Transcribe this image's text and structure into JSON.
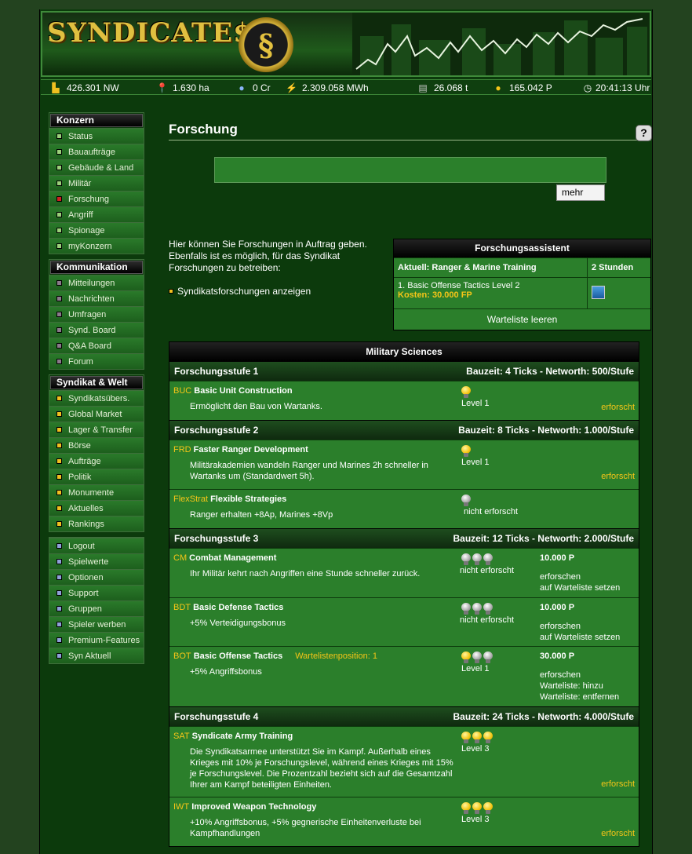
{
  "header": {
    "logo": "SYNDICATE$",
    "emblem_glyph": "§"
  },
  "status": {
    "networth": "426.301 NW",
    "land": "1.630 ha",
    "credits": "0 Cr",
    "energy": "2.309.058 MWh",
    "steel": "26.068 t",
    "points": "165.042 P",
    "time": "20:41:13 Uhr"
  },
  "sidebar": {
    "sections": [
      {
        "title": "Konzern",
        "items": [
          {
            "label": "Status",
            "color": "#9bd07a"
          },
          {
            "label": "Bauaufträge",
            "color": "#9bd07a"
          },
          {
            "label": "Gebäude & Land",
            "color": "#9bd07a"
          },
          {
            "label": "Militär",
            "color": "#9bd07a"
          },
          {
            "label": "Forschung",
            "color": "#cc2222"
          },
          {
            "label": "Angriff",
            "color": "#9bd07a"
          },
          {
            "label": "Spionage",
            "color": "#9bd07a"
          },
          {
            "label": "myKonzern",
            "color": "#9bd07a"
          }
        ]
      },
      {
        "title": "Kommunikation",
        "items": [
          {
            "label": "Mitteilungen",
            "color": "#8a7a8a"
          },
          {
            "label": "Nachrichten",
            "color": "#8a7a8a"
          },
          {
            "label": "Umfragen",
            "color": "#8a7a8a"
          },
          {
            "label": "Synd. Board",
            "color": "#8a7a8a"
          },
          {
            "label": "Q&A Board",
            "color": "#8a7a8a"
          },
          {
            "label": "Forum",
            "color": "#8a7a8a"
          }
        ]
      },
      {
        "title": "Syndikat & Welt",
        "items": [
          {
            "label": "Syndikatsübers.",
            "color": "#f0c020"
          },
          {
            "label": "Global Market",
            "color": "#f0c020"
          },
          {
            "label": "Lager & Transfer",
            "color": "#f0c020"
          },
          {
            "label": "Börse",
            "color": "#f0c020"
          },
          {
            "label": "Aufträge",
            "color": "#f0c020"
          },
          {
            "label": "Politik",
            "color": "#f0c020"
          },
          {
            "label": "Monumente",
            "color": "#f0c020"
          },
          {
            "label": "Aktuelles",
            "color": "#f0c020"
          },
          {
            "label": "Rankings",
            "color": "#f0c020"
          }
        ]
      },
      {
        "title": "",
        "items": [
          {
            "label": "Logout",
            "color": "#8fa0d8"
          },
          {
            "label": "Spielwerte",
            "color": "#8fa0d8"
          },
          {
            "label": "Optionen",
            "color": "#8fa0d8"
          },
          {
            "label": "Support",
            "color": "#8fa0d8"
          },
          {
            "label": "Gruppen",
            "color": "#8fa0d8"
          },
          {
            "label": "Spieler werben",
            "color": "#8fa0d8"
          },
          {
            "label": "Premium-Features",
            "color": "#8fa0d8"
          },
          {
            "label": "Syn Aktuell",
            "color": "#8fa0d8"
          }
        ]
      }
    ]
  },
  "page": {
    "title": "Forschung",
    "help": "?",
    "mehr": "mehr",
    "intro": "Hier können Sie Forschungen in Auftrag geben. Ebenfalls ist es möglich, für das Syndikat Forschungen zu betreiben:",
    "synd_link": "Syndikatsforschungen anzeigen"
  },
  "assistant": {
    "title": "Forschungsassistent",
    "current": "Aktuell: Ranger & Marine Training",
    "duration": "2 Stunden",
    "queue_item": "1. Basic Offense Tactics Level 2",
    "queue_cost": "Kosten: 30.000 FP",
    "clear": "Warteliste leeren"
  },
  "military": {
    "title": "Military Sciences",
    "levels": [
      {
        "name": "Forschungsstufe 1",
        "info": "Bauzeit: 4 Ticks - Networth: 500/Stufe"
      },
      {
        "name": "Forschungsstufe 2",
        "info": "Bauzeit: 8 Ticks - Networth: 1.000/Stufe"
      },
      {
        "name": "Forschungsstufe 3",
        "info": "Bauzeit: 12 Ticks - Networth: 2.000/Stufe"
      },
      {
        "name": "Forschungsstufe 4",
        "info": "Bauzeit: 24 Ticks - Networth: 4.000/Stufe"
      }
    ],
    "research": [
      {
        "code": "BUC",
        "name": "Basic Unit Construction",
        "desc": "Ermöglicht den Bau von Wartanks.",
        "lit": 1,
        "max": 1,
        "status": "Level 1",
        "done": "erforscht"
      },
      {
        "code": "FRD",
        "name": "Faster Ranger Development",
        "desc": "Militärakademien wandeln Ranger und Marines 2h schneller in Wartanks um (Standardwert 5h).",
        "lit": 1,
        "max": 1,
        "status": "Level 1",
        "done": "erforscht"
      },
      {
        "code": "FlexStrat",
        "name": "Flexible Strategies",
        "desc": "Ranger erhalten +8Ap, Marines +8Vp",
        "lit": 0,
        "max": 1,
        "status": "nicht erforscht"
      },
      {
        "code": "CM",
        "name": "Combat Management",
        "desc": "Ihr Militär kehrt nach Angriffen eine Stunde schneller zurück.",
        "lit": 0,
        "max": 3,
        "status": "nicht erforscht",
        "price": "10.000 P",
        "actions": [
          "erforschen",
          "auf Warteliste setzen"
        ]
      },
      {
        "code": "BDT",
        "name": "Basic Defense Tactics",
        "desc": "+5% Verteidigungsbonus",
        "lit": 0,
        "max": 3,
        "status": "nicht erforscht",
        "price": "10.000 P",
        "actions": [
          "erforschen",
          "auf Warteliste setzen"
        ]
      },
      {
        "code": "BOT",
        "name": "Basic Offense Tactics",
        "queue": "Wartelistenposition: 1",
        "desc": "+5% Angriffsbonus",
        "lit": 1,
        "max": 3,
        "status": "Level 1",
        "price": "30.000 P",
        "actions": [
          "erforschen",
          "Warteliste: hinzu",
          "Warteliste: entfernen"
        ]
      },
      {
        "code": "SAT",
        "name": "Syndicate Army Training",
        "desc": "Die Syndikatsarmee unterstützt Sie im Kampf. Außerhalb eines Krieges mit 10% je Forschungslevel, während eines Krieges mit 15% je Forschungslevel. Die Prozentzahl bezieht sich auf die Gesamtzahl Ihrer am Kampf beteiligten Einheiten.",
        "lit": 3,
        "max": 3,
        "status": "Level 3",
        "done": "erforscht"
      },
      {
        "code": "IWT",
        "name": "Improved Weapon Technology",
        "desc": "+10% Angriffsbonus, +5% gegnerische Einheitenverluste bei Kampfhandlungen",
        "lit": 3,
        "max": 3,
        "status": "Level 3",
        "done": "erforscht"
      }
    ]
  }
}
